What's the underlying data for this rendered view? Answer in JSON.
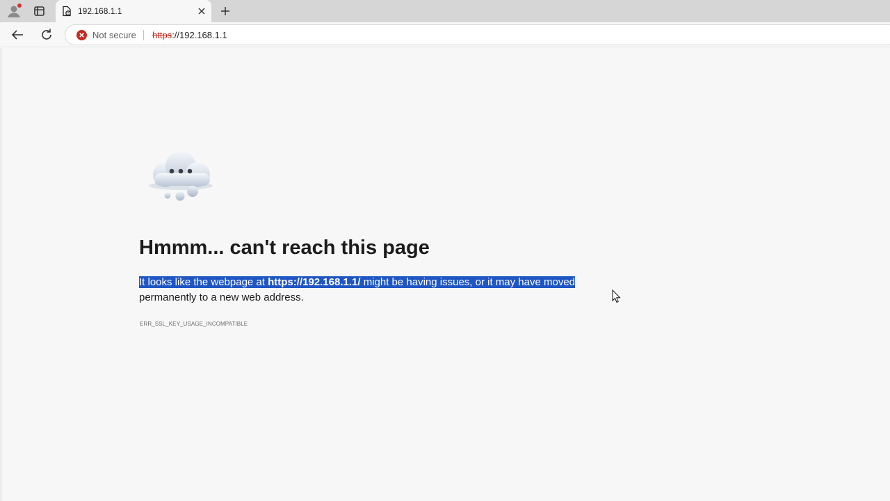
{
  "tab": {
    "title": "192.168.1.1"
  },
  "toolbar": {
    "security_label": "Not secure",
    "url_scheme": "https",
    "url_rest": "://192.168.1.1"
  },
  "error_page": {
    "heading": "Hmmm... can't reach this page",
    "desc_part1": "It looks like the webpage at ",
    "desc_url": "https://192.168.1.1/",
    "desc_part2": " might be having issues, or it may have moved",
    "desc_part3": " permanently to a new web address.",
    "error_code": "ERR_SSL_KEY_USAGE_INCOMPATIBLE"
  },
  "colors": {
    "tabstrip_bg": "#d6d6d6",
    "page_bg": "#f7f7f7",
    "selection": "#1f56c4",
    "warning_red": "#c42b1c",
    "profile_notification": "#d13438"
  },
  "icons": {
    "profile": "profile-icon",
    "tab_actions": "tab-actions-icon",
    "favicon": "document-warning-icon",
    "close": "close-icon",
    "new_tab": "plus-icon",
    "back": "back-arrow-icon",
    "reload": "reload-icon",
    "security": "error-circle-icon",
    "illustration": "cloud-icon"
  }
}
